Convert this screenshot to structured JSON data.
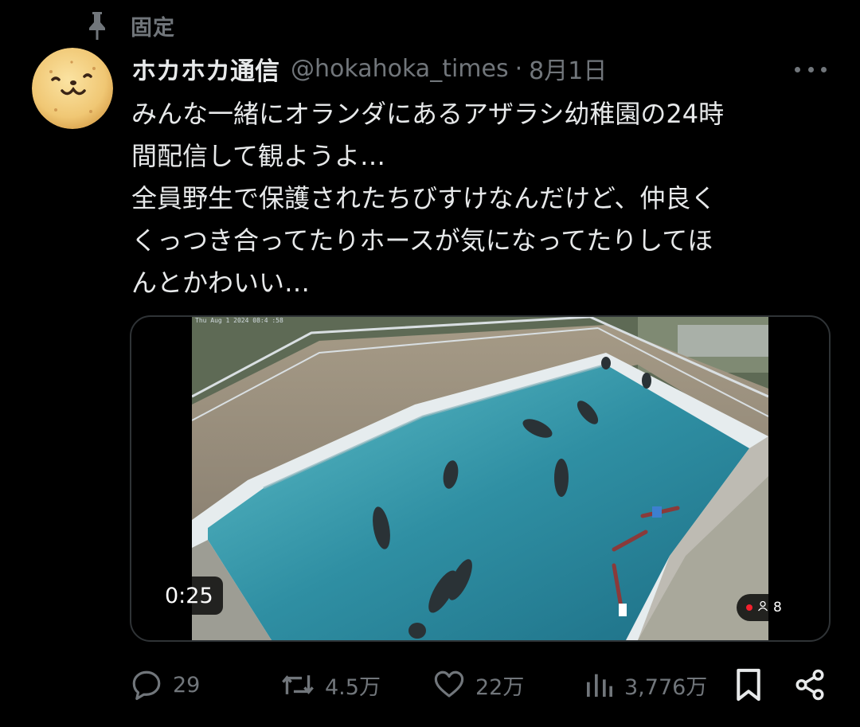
{
  "pinned": {
    "label": "固定"
  },
  "author": {
    "display_name": "ホカホカ通信",
    "handle": "@hokahoka_times",
    "separator": "·",
    "date": "8月1日"
  },
  "tweet": {
    "text": "みんな一緒にオランダにあるアザラシ幼稚園の24時\n間配信して観ようよ…\n全員野生で保護されたちびすけなんだけど、仲良く\nくっつき合ってたりホースが気になってたりしてほ\nんとかわいい…"
  },
  "media": {
    "cam_timestamp": "Thu Aug  1 2024 08:4 :58",
    "duration": "0:25",
    "viewer_count": "8"
  },
  "actions": {
    "replies": "29",
    "reposts": "4.5万",
    "likes": "22万",
    "views": "3,776万"
  },
  "icons": {
    "pin": "pin-icon",
    "more": "more-icon",
    "reply": "reply-icon",
    "repost": "repost-icon",
    "like": "heart-icon",
    "views": "views-icon",
    "bookmark": "bookmark-icon",
    "share": "share-icon"
  },
  "colors": {
    "background": "#000000",
    "text_primary": "#e7e9ea",
    "text_secondary": "#71767b",
    "live": "#f4212e",
    "pool_water": "#2e8fa0"
  }
}
